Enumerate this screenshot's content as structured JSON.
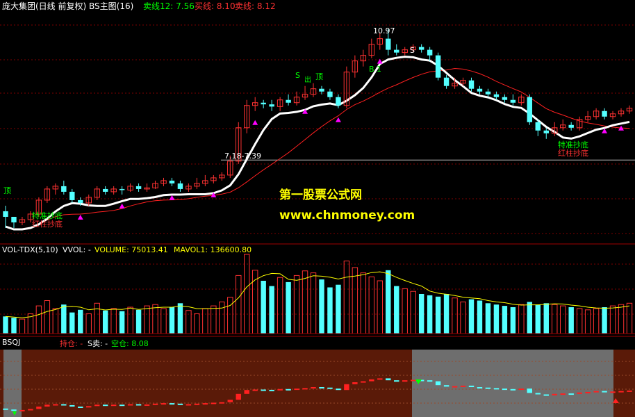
{
  "header": {
    "title": "庞大集团(日线 前复权) BS主图(16)",
    "ma12": "卖线12: 7.56",
    "ma_a": "买线: 8.10",
    "ma_b": "卖线: 8.12"
  },
  "annotations": {
    "high_price": "10.97",
    "range_label": "7.18-7.39",
    "b1": "B 1",
    "s_label": "S",
    "s_label2": "S",
    "top_label": "顶",
    "top_label2": "顶",
    "top_label3": "出",
    "bottom_left1": "特准抄底",
    "bottom_left2": "红柱抄底",
    "bottom_right1": "特准抄底",
    "bottom_right2": "红柱抄底"
  },
  "watermark": {
    "line1": "第一股票公式网",
    "line2": "www.chnmoney.com"
  },
  "volume_panel": {
    "title": "VOL-TDX(5,10)",
    "vvol": "VVOL: -",
    "volume": "VOLUME: 75013.41",
    "mavol": "MAVOL1: 136600.80"
  },
  "bsqj_panel": {
    "title": "BSQJ",
    "hold": "持仓: -",
    "sell": "S卖: -",
    "empty": "空仓: 8.08"
  },
  "colors": {
    "up": "#ff3232",
    "down": "#54ffff",
    "white_line": "#ffffff",
    "red_line": "#ff2020",
    "yellow_text": "#ffff00",
    "green_text": "#00ff00",
    "magenta": "#ff00ff",
    "panel_brown": "#5a1a08",
    "panel_gray": "#6e6e6e",
    "grid": "#800000"
  },
  "chart_data": {
    "type": "candlestick",
    "price_axis_visible": false,
    "candles": [
      [
        7.7,
        7.6,
        7.8,
        7.4
      ],
      [
        7.6,
        7.5,
        7.6,
        7.4
      ],
      [
        7.5,
        7.55,
        7.6,
        7.45
      ],
      [
        7.55,
        7.65,
        7.7,
        7.5
      ],
      [
        7.65,
        7.9,
        7.95,
        7.6
      ],
      [
        7.9,
        8.1,
        8.15,
        7.85
      ],
      [
        8.1,
        8.15,
        8.2,
        8.0
      ],
      [
        8.15,
        8.05,
        8.25,
        8.0
      ],
      [
        8.05,
        7.9,
        8.1,
        7.85
      ],
      [
        7.9,
        7.85,
        7.95,
        7.8
      ],
      [
        7.85,
        7.95,
        8.0,
        7.8
      ],
      [
        7.95,
        8.1,
        8.15,
        7.9
      ],
      [
        8.1,
        8.05,
        8.15,
        8.0
      ],
      [
        8.05,
        8.1,
        8.15,
        8.0
      ],
      [
        8.1,
        8.08,
        8.15,
        8.0
      ],
      [
        8.08,
        8.15,
        8.2,
        8.05
      ],
      [
        8.15,
        8.1,
        8.2,
        8.05
      ],
      [
        8.1,
        8.12,
        8.2,
        8.05
      ],
      [
        8.12,
        8.2,
        8.25,
        8.1
      ],
      [
        8.2,
        8.25,
        8.3,
        8.15
      ],
      [
        8.25,
        8.2,
        8.3,
        8.15
      ],
      [
        8.2,
        8.1,
        8.25,
        8.05
      ],
      [
        8.1,
        8.15,
        8.2,
        8.05
      ],
      [
        8.15,
        8.2,
        8.3,
        8.1
      ],
      [
        8.2,
        8.25,
        8.35,
        8.15
      ],
      [
        8.25,
        8.3,
        8.35,
        8.2
      ],
      [
        8.3,
        8.35,
        8.4,
        8.25
      ],
      [
        8.35,
        8.6,
        8.7,
        8.3
      ],
      [
        8.6,
        9.2,
        9.3,
        8.55
      ],
      [
        9.2,
        9.6,
        9.7,
        9.1
      ],
      [
        9.6,
        9.65,
        9.75,
        9.5
      ],
      [
        9.65,
        9.62,
        9.7,
        9.55
      ],
      [
        9.62,
        9.58,
        9.7,
        9.5
      ],
      [
        9.58,
        9.7,
        9.75,
        9.5
      ],
      [
        9.7,
        9.65,
        9.8,
        9.6
      ],
      [
        9.65,
        9.75,
        9.85,
        9.6
      ],
      [
        9.75,
        9.8,
        9.95,
        9.7
      ],
      [
        9.8,
        9.9,
        10.0,
        9.75
      ],
      [
        9.9,
        9.85,
        9.95,
        9.8
      ],
      [
        9.85,
        9.75,
        9.9,
        9.7
      ],
      [
        9.75,
        9.6,
        9.8,
        9.55
      ],
      [
        9.6,
        10.2,
        10.3,
        9.55
      ],
      [
        10.2,
        10.4,
        10.5,
        10.1
      ],
      [
        10.4,
        10.5,
        10.6,
        10.3
      ],
      [
        10.5,
        10.7,
        10.8,
        10.45
      ],
      [
        10.7,
        10.8,
        10.9,
        10.6
      ],
      [
        10.8,
        10.6,
        10.97,
        10.5
      ],
      [
        10.6,
        10.55,
        10.7,
        10.5
      ],
      [
        10.55,
        10.6,
        10.65,
        10.5
      ],
      [
        10.6,
        10.65,
        10.7,
        10.55
      ],
      [
        10.65,
        10.6,
        10.7,
        10.55
      ],
      [
        10.6,
        10.5,
        10.65,
        10.4
      ],
      [
        10.5,
        10.1,
        10.55,
        10.05
      ],
      [
        10.1,
        9.95,
        10.15,
        9.9
      ],
      [
        9.95,
        10.0,
        10.1,
        9.9
      ],
      [
        10.0,
        10.05,
        10.1,
        9.95
      ],
      [
        10.05,
        9.9,
        10.1,
        9.85
      ],
      [
        9.9,
        9.85,
        9.95,
        9.8
      ],
      [
        9.85,
        9.8,
        9.9,
        9.75
      ],
      [
        9.8,
        9.75,
        9.85,
        9.7
      ],
      [
        9.75,
        9.7,
        9.8,
        9.65
      ],
      [
        9.7,
        9.65,
        9.8,
        9.6
      ],
      [
        9.65,
        9.75,
        9.8,
        9.6
      ],
      [
        9.75,
        9.3,
        9.8,
        9.25
      ],
      [
        9.3,
        9.15,
        9.35,
        9.05
      ],
      [
        9.15,
        9.1,
        9.2,
        9.0
      ],
      [
        9.1,
        9.2,
        9.3,
        9.05
      ],
      [
        9.2,
        9.25,
        9.35,
        9.15
      ],
      [
        9.25,
        9.2,
        9.3,
        9.15
      ],
      [
        9.2,
        9.35,
        9.4,
        9.15
      ],
      [
        9.35,
        9.4,
        9.5,
        9.3
      ],
      [
        9.4,
        9.5,
        9.55,
        9.35
      ],
      [
        9.5,
        9.4,
        9.55,
        9.35
      ],
      [
        9.4,
        9.45,
        9.5,
        9.35
      ],
      [
        9.45,
        9.5,
        9.55,
        9.4
      ],
      [
        9.5,
        9.55,
        9.6,
        9.45
      ]
    ],
    "volume": [
      26,
      24,
      22,
      30,
      42,
      50,
      38,
      44,
      32,
      36,
      30,
      46,
      35,
      38,
      34,
      40,
      36,
      42,
      44,
      38,
      40,
      46,
      35,
      30,
      38,
      42,
      48,
      55,
      88,
      120,
      96,
      80,
      72,
      85,
      78,
      88,
      95,
      92,
      82,
      70,
      74,
      110,
      100,
      92,
      86,
      80,
      96,
      72,
      68,
      64,
      60,
      58,
      56,
      60,
      54,
      48,
      52,
      50,
      46,
      44,
      42,
      40,
      44,
      48,
      44,
      46,
      44,
      42,
      40,
      38,
      36,
      38,
      40,
      42,
      44,
      46
    ]
  }
}
